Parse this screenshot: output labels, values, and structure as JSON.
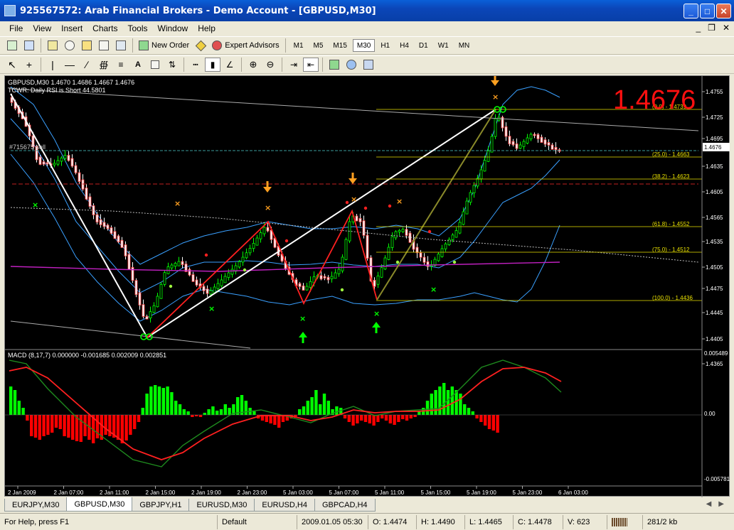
{
  "window": {
    "title": "925567572: Arab Financial Brokers - Demo Account - [GBPUSD,M30]"
  },
  "menu": [
    "File",
    "View",
    "Insert",
    "Charts",
    "Tools",
    "Window",
    "Help"
  ],
  "mdi_buttons": [
    "_",
    "❒",
    "✕"
  ],
  "toolbar1": {
    "new_order": "New Order",
    "expert_advisors": "Expert Advisors",
    "timeframes": [
      "M1",
      "M5",
      "M15",
      "M30",
      "H1",
      "H4",
      "D1",
      "W1",
      "MN"
    ],
    "active_timeframe": "M30"
  },
  "chart": {
    "header_line1": "GBPUSD,M30  1.4670 1.4686 1.4667 1.4676",
    "header_line2": "TCWR: Daily RSI is Short 44.5801",
    "big_price": "1.4676",
    "order_label": "#715675 sell",
    "price_axis": [
      "1.4755",
      "1.4725",
      "1.4695",
      "1.4676",
      "1.4635",
      "1.4605",
      "1.4565",
      "1.4535",
      "1.4505",
      "1.4475",
      "1.4445",
      "1.4405",
      "1.4365"
    ],
    "current_price": "1.4676",
    "fib_levels": [
      {
        "label": "(0.0) - 1.4739",
        "color": "#e8e000"
      },
      {
        "label": "(25.0) - 1.4663",
        "color": "#e8e000"
      },
      {
        "label": "(38.2) - 1.4623",
        "color": "#e8e000"
      },
      {
        "label": "(61.8) - 1.4552",
        "color": "#e8e000"
      },
      {
        "label": "(75.0) - 1.4512",
        "color": "#e8e000"
      },
      {
        "label": "(100.0) - 1.4436",
        "color": "#e8e000"
      }
    ],
    "macd_label": "MACD  (8,17,7) 0.000000 -0.001685 0.002009 0.002851",
    "macd_axis": [
      "0.005489",
      "0.00",
      "-0.005781"
    ],
    "time_axis": [
      "2 Jan 2009",
      "2 Jan 07:00",
      "2 Jan 11:00",
      "2 Jan 15:00",
      "2 Jan 19:00",
      "2 Jan 23:00",
      "5 Jan 03:00",
      "5 Jan 07:00",
      "5 Jan 11:00",
      "5 Jan 15:00",
      "5 Jan 19:00",
      "5 Jan 23:00",
      "6 Jan 03:00"
    ],
    "colors": {
      "bull": "#00ff00",
      "bear": "#ff0000",
      "big_price": "#ff1010",
      "fib": "#e8e000",
      "bollinger": "#3aa0ff",
      "zigzag": "#ff2020",
      "trend": "#ffffff",
      "macd_signal": "#ff2020",
      "macd_line": "#1e8a1e",
      "ma": "#c020c0"
    }
  },
  "tabs": [
    "EURJPY,M30",
    "GBPUSD,M30",
    "GBPJPY,H1",
    "EURUSD,M30",
    "EURUSD,H4",
    "GBPCAD,H4"
  ],
  "active_tab": "GBPUSD,M30",
  "status": {
    "help": "For Help, press F1",
    "profile": "Default",
    "datetime": "2009.01.05 05:30",
    "open": "O: 1.4474",
    "high": "H: 1.4490",
    "low": "L: 1.4465",
    "close": "C: 1.4478",
    "volume": "V: 623",
    "traffic": "281/2 kb"
  }
}
